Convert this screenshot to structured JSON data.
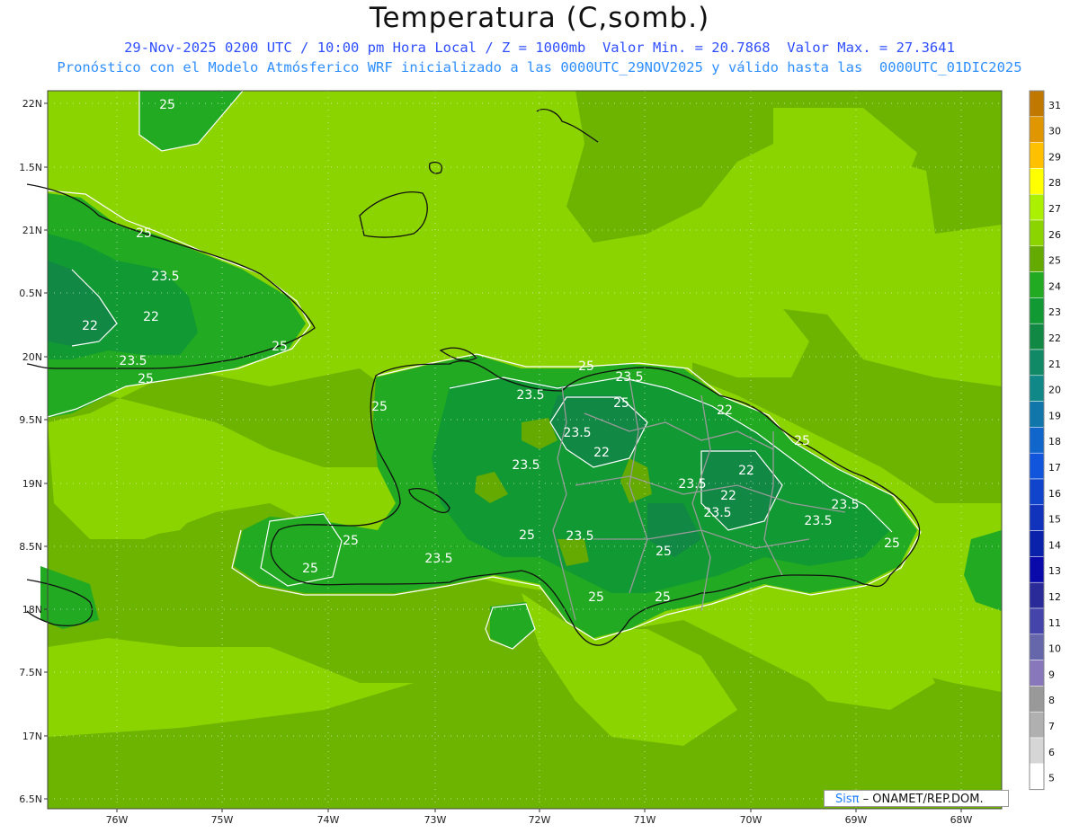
{
  "header": {
    "title": "Temperatura (C,somb.)",
    "line1": "29-Nov-2025 0200 UTC / 10:00 pm Hora Local / Z = 1000mb  Valor Min. = 20.7868  Valor Max. = 27.3641",
    "line2": "Pronóstico con el Modelo Atmósferico WRF inicializado a las 0000UTC_29NOV2025 y válido hasta las  0000UTC_01DIC2025"
  },
  "axes": {
    "lat_labels": [
      "22N",
      "1.5N",
      "21N",
      "0.5N",
      "20N",
      "9.5N",
      "19N",
      "8.5N",
      "18N",
      "7.5N",
      "17N",
      "6.5N"
    ],
    "lon_labels": [
      "76W",
      "75W",
      "74W",
      "73W",
      "72W",
      "71W",
      "70W",
      "69W",
      "68W"
    ]
  },
  "contour_labels": [
    "25",
    "25",
    "23.5",
    "22",
    "22",
    "25",
    "23.5",
    "25",
    "25",
    "25",
    "23.5",
    "25",
    "23.5",
    "22",
    "23.5",
    "22",
    "23.5",
    "25",
    "23.5",
    "22",
    "22",
    "23.5",
    "23.5",
    "25",
    "23.5",
    "23.5",
    "25",
    "25",
    "25",
    "25",
    "25",
    "23.5",
    "25"
  ],
  "colorbar": {
    "labels": [
      "31",
      "30",
      "29",
      "28",
      "27",
      "26",
      "25",
      "24",
      "23",
      "22",
      "21",
      "20",
      "19",
      "18",
      "17",
      "16",
      "15",
      "14",
      "13",
      "12",
      "11",
      "10",
      "9",
      "8",
      "7",
      "6",
      "5"
    ],
    "colors": [
      "#c07800",
      "#e09600",
      "#ffc000",
      "#ffff00",
      "#aaf000",
      "#8cd400",
      "#64aa00",
      "#22aa22",
      "#119933",
      "#118844",
      "#118866",
      "#118888",
      "#1177aa",
      "#1166cc",
      "#1155dd",
      "#1144cc",
      "#1133bb",
      "#0a22aa",
      "#0a0aaa",
      "#2a2a99",
      "#4444aa",
      "#6666aa",
      "#8877bb",
      "#999999",
      "#b0b0b0",
      "#d6d6d6",
      "#ffffff"
    ]
  },
  "credit": {
    "brand": "Sisπ",
    "org": " – ONAMET/REP.DOM."
  }
}
